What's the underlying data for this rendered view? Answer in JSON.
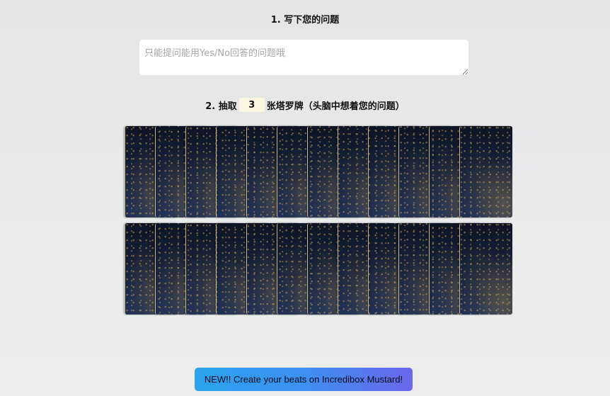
{
  "step1": {
    "label": "1. 写下您的问题"
  },
  "question": {
    "value": "",
    "placeholder": "只能提问能用Yes/No回答的问题哦"
  },
  "step2": {
    "prefix": "2. 抽取",
    "count": "3",
    "suffix": "张塔罗牌（头脑中想着您的问题）"
  },
  "deck": {
    "rows": 2,
    "cards_per_row": 12,
    "card_back": "starry-night-tarot-back"
  },
  "promo": {
    "label": "NEW!! Create your beats on Incredibox Mustard!"
  },
  "colors": {
    "background": "#e6e7e8",
    "count_bg": "#fbf6e0",
    "card_dark": "#0d1424",
    "card_light": "#1f3158",
    "promo_start": "#2aa4ee",
    "promo_end": "#6a67ea"
  }
}
